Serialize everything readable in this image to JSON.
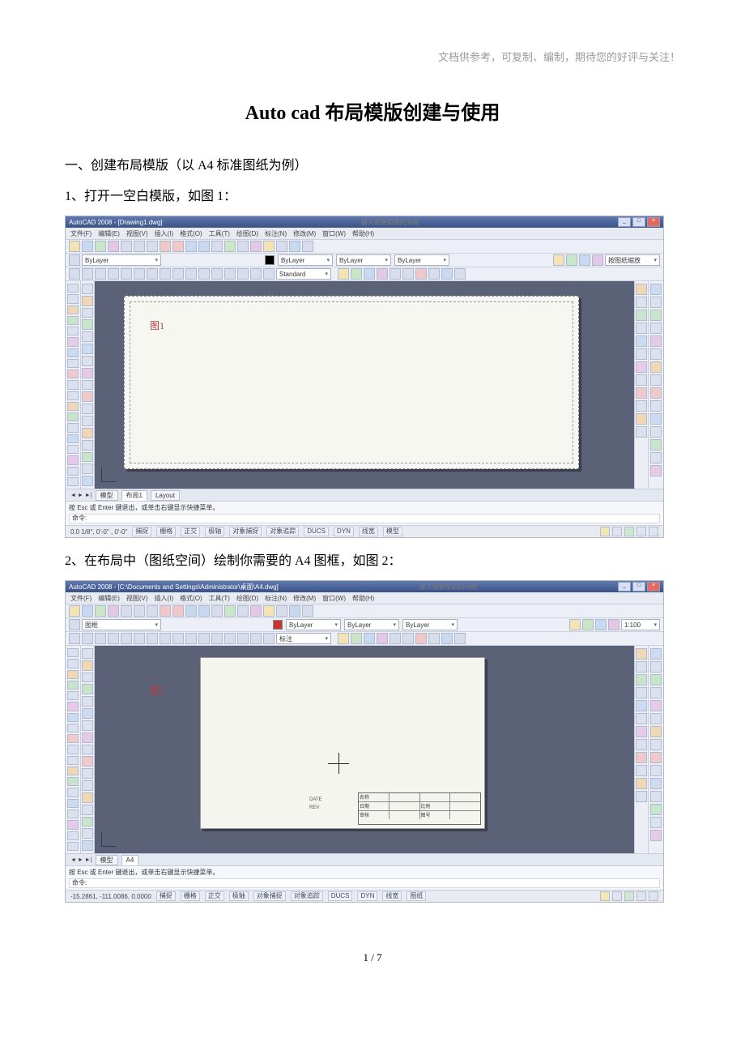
{
  "header_note": "文档供参考，可复制、编制，期待您的好评与关注！",
  "title_latin": "Auto cad",
  "title_cn": " 布局模版创建与使用",
  "section1": "一、创建布局模版（以 A4 标准图纸为例）",
  "step1": "1、打开一空白模版，如图 1：",
  "step2": "2、在布局中（图纸空间）绘制你需要的 A4 图框，如图 2：",
  "page_footer": "1 / 7",
  "screenshot1": {
    "title": "AutoCAD 2008 - [Drawing1.dwg]",
    "menus": [
      "文件(F)",
      "编辑(E)",
      "视图(V)",
      "插入(I)",
      "格式(O)",
      "工具(T)",
      "绘图(D)",
      "标注(N)",
      "修改(M)",
      "窗口(W)",
      "帮助(H)"
    ],
    "layer_sel": "ByLayer",
    "linetype_sel": "ByLayer",
    "lineweight_sel": "ByLayer",
    "color_sel": "ByLayer",
    "textstyle": "Standard",
    "fig_label": "图1",
    "tabs": [
      "模型",
      "布局1",
      "Layout"
    ],
    "active_tab_index": 1,
    "cmd_hint": "按 Esc 或 Enter 键退出，或单击右键显示快捷菜单。",
    "cmd_prompt": "命令:",
    "coords": "0.0 1/8\",  0'-0\"  , 0'-0\"",
    "status_buttons": [
      "捕捉",
      "栅格",
      "正交",
      "极轴",
      "对象捕捉",
      "对象追踪",
      "DUCS",
      "DYN",
      "线宽",
      "模型"
    ],
    "search_placeholder": "键入需要帮助的问题"
  },
  "screenshot2": {
    "title": "AutoCAD 2008 - [C:\\Documents and Settings\\Administrator\\桌面\\A4.dwg]",
    "menus": [
      "文件(F)",
      "编辑(E)",
      "视图(V)",
      "插入(I)",
      "格式(O)",
      "工具(T)",
      "绘图(D)",
      "标注(N)",
      "修改(M)",
      "窗口(W)",
      "帮助(H)"
    ],
    "layer_sel": "图框",
    "linetype_sel": "ByLayer",
    "lineweight_sel": "ByLayer",
    "color_sel": "ByLayer",
    "scale_sel": "1:100",
    "annoscale": "标注",
    "fig_label": "图2",
    "tabs": [
      "模型",
      "A4"
    ],
    "active_tab_index": 1,
    "cmd_hint": "按 Esc 或 Enter 键退出，或单击右键显示快捷菜单。",
    "cmd_prompt": "命令:",
    "coords": "-15.2861, -111.0086, 0.0000",
    "status_buttons": [
      "捕捉",
      "栅格",
      "正交",
      "极轴",
      "对象捕捉",
      "对象追踪",
      "DUCS",
      "DYN",
      "线宽",
      "图纸"
    ],
    "search_placeholder": "键入需要帮助的问题",
    "titleblock": {
      "row1": [
        "名称",
        "",
        "",
        ""
      ],
      "row2": [
        "日期",
        "",
        "比例",
        ""
      ],
      "row3": [
        "审核",
        "",
        "图号",
        ""
      ]
    },
    "side_labels": {
      "rev": "REV",
      "date": "DATE"
    }
  }
}
